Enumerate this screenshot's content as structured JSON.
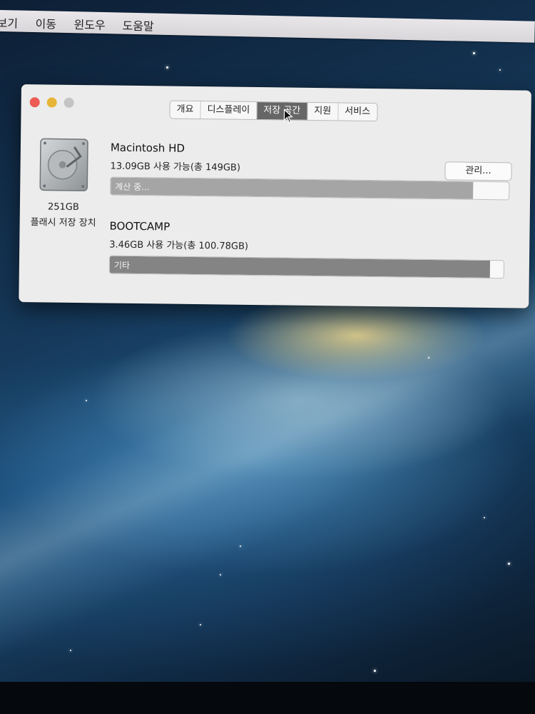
{
  "menubar": {
    "items": [
      "보기",
      "이동",
      "윈도우",
      "도움말"
    ]
  },
  "window": {
    "tabs": [
      {
        "label": "개요",
        "active": false
      },
      {
        "label": "디스플레이",
        "active": false
      },
      {
        "label": "저장 공간",
        "active": true
      },
      {
        "label": "지원",
        "active": false
      },
      {
        "label": "서비스",
        "active": false
      }
    ],
    "disk": {
      "icon": "hard-drive-icon",
      "size": "251GB",
      "label": "플래시 저장 장치"
    },
    "volumes": [
      {
        "name": "Macintosh HD",
        "info": "13.09GB 사용 가능(총 149GB)",
        "bar_text": "계산 중...",
        "bar_fill_fraction": 0.91
      },
      {
        "name": "BOOTCAMP",
        "info": "3.46GB 사용 가능(총 100.78GB)",
        "bar_text": "기타",
        "bar_fill_fraction": 0.966
      }
    ],
    "manage_button": "관리..."
  },
  "colors": {
    "close": "#ec5b54",
    "minimize": "#e7b537",
    "maximize": "#c4c4c4",
    "active_tab": "#666666"
  }
}
